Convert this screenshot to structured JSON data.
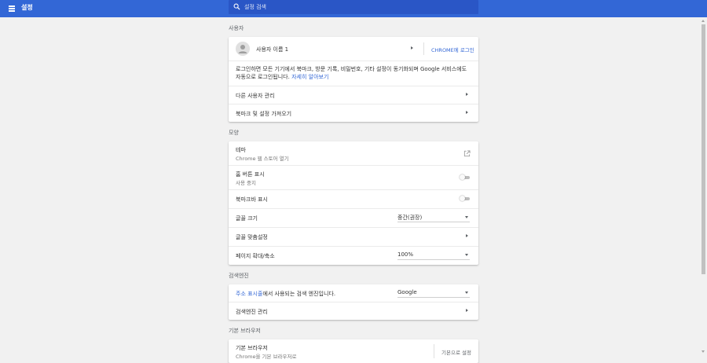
{
  "header": {
    "title": "설정",
    "search_placeholder": "설정 검색"
  },
  "people": {
    "section_title": "사용자",
    "user_name": "사용자 이름 1",
    "signin_label": "CHROME에 로그인",
    "description_text": "로그인하면 모든 기기에서 북마크, 방문 기록, 비밀번호, 기타 설정이 동기화되며 Google 서비스에도 자동으로 로그인됩니다.",
    "learn_more": "자세히 알아보기",
    "manage_people": "다른 사용자 관리",
    "import_bookmarks": "북마크 및 설정 가져오기"
  },
  "appearance": {
    "section_title": "모양",
    "theme_label": "테마",
    "theme_sub": "Chrome 웹 스토어 열기",
    "home_button_label": "홈 버튼 표시",
    "home_button_sub": "사용 중지",
    "home_button_on": false,
    "bookmarks_bar_label": "북마크바 표시",
    "bookmarks_bar_on": false,
    "font_size_label": "글꼴 크기",
    "font_size_value": "중간(권장)",
    "customize_fonts": "글꼴 맞춤설정",
    "zoom_label": "페이지 확대/축소",
    "zoom_value": "100%"
  },
  "search_engine": {
    "section_title": "검색엔진",
    "address_bar_link": "주소 표시줄",
    "address_bar_rest": "에서 사용되는 검색 엔진입니다.",
    "engine_value": "Google",
    "manage_label": "검색엔진 관리"
  },
  "default_browser": {
    "section_title": "기본 브라우저",
    "label": "기본 브라우저",
    "sub": "Chrome을 기본 브라우저로",
    "make_default": "기본으로 설정"
  },
  "colors": {
    "accent": "#3367d6",
    "header_bg": "#3367d6",
    "search_bg": "#2a56c6",
    "page_bg": "#f1f1f1"
  }
}
